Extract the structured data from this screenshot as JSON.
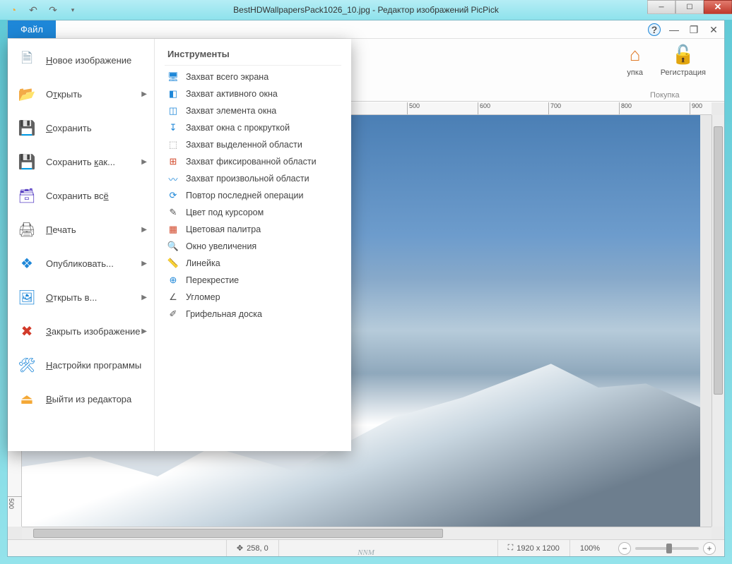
{
  "window": {
    "title": "BestHDWallpapersPack1026_10.jpg - Редактор изображений PicPick"
  },
  "ribbon": {
    "file_tab": "Файл",
    "purchase_group_label": "Покупка",
    "purchase_item1": "упка",
    "register_item": "Регистрация"
  },
  "file_menu": {
    "items": [
      {
        "label_pre": "",
        "u": "Н",
        "label_post": "овое изображение",
        "has_sub": false,
        "icon": "new-doc-icon",
        "glyph": "🗎",
        "color": "#8aa4b4"
      },
      {
        "label_pre": "О",
        "u": "т",
        "label_post": "крыть",
        "has_sub": true,
        "icon": "open-icon",
        "glyph": "📂",
        "color": "#f4a836"
      },
      {
        "label_pre": "",
        "u": "С",
        "label_post": "охранить",
        "has_sub": false,
        "icon": "save-icon",
        "glyph": "💾",
        "color": "#5b43c4"
      },
      {
        "label_pre": "Сохранить ",
        "u": "к",
        "label_post": "ак...",
        "has_sub": true,
        "icon": "saveas-icon",
        "glyph": "💾",
        "color": "#5b43c4"
      },
      {
        "label_pre": "Сохранить вс",
        "u": "ё",
        "label_post": "",
        "has_sub": false,
        "icon": "saveall-icon",
        "glyph": "🗃",
        "color": "#5b43c4"
      },
      {
        "label_pre": "",
        "u": "П",
        "label_post": "ечать",
        "has_sub": true,
        "icon": "print-icon",
        "glyph": "🖨",
        "color": "#6b6b6b"
      },
      {
        "label_pre": "Опубликовать",
        "u": "",
        "label_post": "...",
        "has_sub": true,
        "icon": "share-icon",
        "glyph": "❖",
        "color": "#1e87d8"
      },
      {
        "label_pre": "",
        "u": "О",
        "label_post": "ткрыть в...",
        "has_sub": true,
        "icon": "openin-icon",
        "glyph": "🖼",
        "color": "#1e87d8"
      },
      {
        "label_pre": "",
        "u": "З",
        "label_post": "акрыть изображение",
        "has_sub": true,
        "icon": "closeimg-icon",
        "glyph": "✖",
        "color": "#d23b2a"
      },
      {
        "label_pre": "",
        "u": "Н",
        "label_post": "астройки программы",
        "has_sub": false,
        "icon": "settings-icon",
        "glyph": "🛠",
        "color": "#1e87d8"
      },
      {
        "label_pre": "",
        "u": "В",
        "label_post": "ыйти из редактора",
        "has_sub": false,
        "icon": "exit-icon",
        "glyph": "⏏",
        "color": "#f4a836"
      }
    ],
    "tools_header": "Инструменты",
    "tools": [
      {
        "label": "Захват всего экрана",
        "icon": "capture-fullscreen-icon",
        "glyph": "🖥",
        "color": "#1e87d8"
      },
      {
        "label": "Захват активного окна",
        "icon": "capture-activewindow-icon",
        "glyph": "◧",
        "color": "#1e87d8"
      },
      {
        "label": "Захват элемента окна",
        "icon": "capture-control-icon",
        "glyph": "◫",
        "color": "#1e87d8"
      },
      {
        "label": "Захват окна с прокруткой",
        "icon": "capture-scroll-icon",
        "glyph": "↧",
        "color": "#1e87d8"
      },
      {
        "label": "Захват выделенной области",
        "icon": "capture-region-icon",
        "glyph": "⬚",
        "color": "#999"
      },
      {
        "label": "Захват фиксированной области",
        "icon": "capture-fixed-icon",
        "glyph": "⊞",
        "color": "#d2482a"
      },
      {
        "label": "Захват произвольной области",
        "icon": "capture-freehand-icon",
        "glyph": "〰",
        "color": "#1e87d8"
      },
      {
        "label": "Повтор последней операции",
        "icon": "repeat-icon",
        "glyph": "⟳",
        "color": "#1e87d8"
      },
      {
        "label": "Цвет под курсором",
        "icon": "colorpicker-icon",
        "glyph": "✎",
        "color": "#555"
      },
      {
        "label": "Цветовая палитра",
        "icon": "palette-icon",
        "glyph": "▦",
        "color": "#d2482a"
      },
      {
        "label": "Окно увеличения",
        "icon": "magnifier-icon",
        "glyph": "🔍",
        "color": "#1e87d8"
      },
      {
        "label": "Линейка",
        "icon": "ruler-icon",
        "glyph": "📏",
        "color": "#d88b2a"
      },
      {
        "label": "Перекрестие",
        "icon": "crosshair-icon",
        "glyph": "⊕",
        "color": "#1e87d8"
      },
      {
        "label": "Угломер",
        "icon": "protractor-icon",
        "glyph": "∠",
        "color": "#555"
      },
      {
        "label": "Грифельная доска",
        "icon": "whiteboard-icon",
        "glyph": "✐",
        "color": "#555"
      }
    ]
  },
  "ruler_ticks_h": [
    "500",
    "600",
    "700",
    "800",
    "900"
  ],
  "ruler_ticks_v": [
    "500"
  ],
  "status": {
    "coords_prefix": "✥",
    "coords": "258, 0",
    "dims_prefix": "⛶",
    "dims": "1920 x 1200",
    "zoom": "100%"
  },
  "watermark": "NNM"
}
